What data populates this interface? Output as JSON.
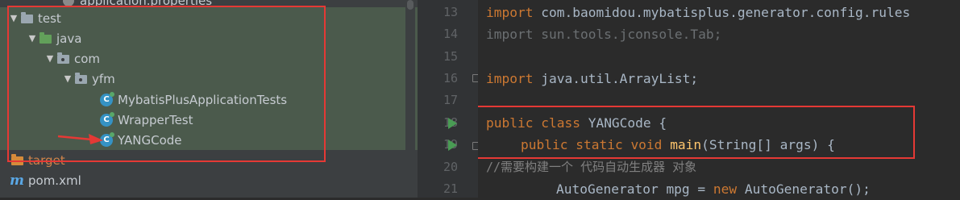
{
  "project_tree": {
    "rows": [
      {
        "label": "application.properties",
        "icon": "properties-file-icon",
        "depth": 4
      },
      {
        "label": "test",
        "icon": "folder-icon",
        "arrow": "▼",
        "depth": 0
      },
      {
        "label": "java",
        "icon": "test-sources-folder-icon",
        "arrow": "▼",
        "depth": 1
      },
      {
        "label": "com",
        "icon": "package-icon",
        "arrow": "▼",
        "depth": 2
      },
      {
        "label": "yfm",
        "icon": "package-icon",
        "arrow": "▼",
        "depth": 3
      },
      {
        "label": "MybatisPlusApplicationTests",
        "icon": "java-class-icon",
        "depth": 4
      },
      {
        "label": "WrapperTest",
        "icon": "java-class-icon",
        "depth": 4
      },
      {
        "label": "YANGCode",
        "icon": "java-class-icon",
        "depth": 4
      },
      {
        "label": "target",
        "icon": "excluded-folder-icon",
        "depth": 0
      },
      {
        "label": "pom.xml",
        "icon": "maven-icon",
        "depth": 0
      }
    ]
  },
  "editor": {
    "line_numbers": [
      "13",
      "14",
      "15",
      "16",
      "17",
      "18",
      "19",
      "20",
      "21"
    ],
    "lines": {
      "l13_kw": "import",
      "l13_rest": " com.baomidou.mybatisplus.generator.config.rules",
      "l14": "import sun.tools.jconsole.Tab;",
      "l16_kw": "import",
      "l16_rest": " java.util.ArrayList;",
      "l18_kw1": "public class",
      "l18_rest": " YANGCode {",
      "l19_kw": "public static void",
      "l19_fn": "main",
      "l19_rest": "(String[] args) {",
      "l20": "//需要构建一个 代码自动生成器 对象",
      "l21_a": "AutoGenerator mpg = ",
      "l21_kw": "new",
      "l21_b": " AutoGenerator();"
    }
  },
  "colors": {
    "annotation_red": "#e53935",
    "keyword": "#cc7832",
    "function": "#ffc66d",
    "comment": "#808080",
    "run_marker": "#499c54"
  }
}
